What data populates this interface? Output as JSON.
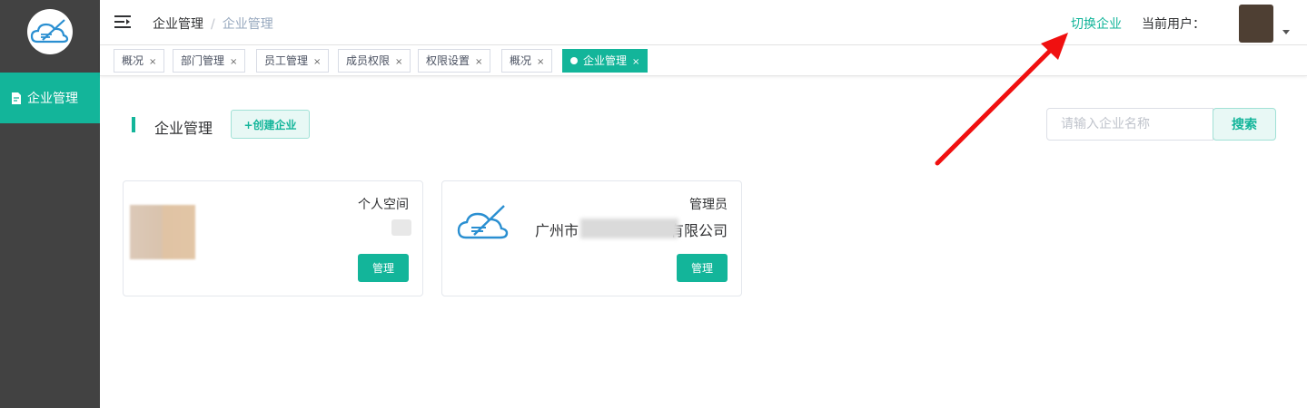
{
  "sidebar": {
    "logo_icon": "cloud-pen-logo",
    "menu": [
      {
        "label": "企业管理",
        "icon": "document-icon",
        "active": true
      }
    ]
  },
  "navbar": {
    "menu_toggle_icon": "hamburger-icon",
    "breadcrumb": [
      "企业管理",
      "企业管理"
    ],
    "breadcrumb_sep": "/",
    "switch_enterprise": "切换企业",
    "current_user_label": "当前用户："
  },
  "tags": [
    {
      "label": "概况",
      "close": "×"
    },
    {
      "label": "部门管理",
      "close": "×"
    },
    {
      "label": "员工管理",
      "close": "×"
    },
    {
      "label": "成员权限",
      "close": "×"
    },
    {
      "label": "权限设置",
      "close": "×"
    },
    {
      "label": "概况",
      "close": "×"
    },
    {
      "label": "企业管理",
      "close": "×",
      "active": true
    }
  ],
  "main": {
    "title": "企业管理",
    "create_button": "+创建企业",
    "search": {
      "placeholder": "请输入企业名称",
      "button": "搜索"
    },
    "cards": [
      {
        "role": "个人空间",
        "name": "",
        "manage": "管理"
      },
      {
        "role": "管理员",
        "name_prefix": "广州市",
        "name_suffix": "有限公司",
        "manage": "管理"
      }
    ]
  },
  "colors": {
    "accent": "#13b59a",
    "sidebar": "#424242",
    "annotation_arrow": "#f01010"
  }
}
